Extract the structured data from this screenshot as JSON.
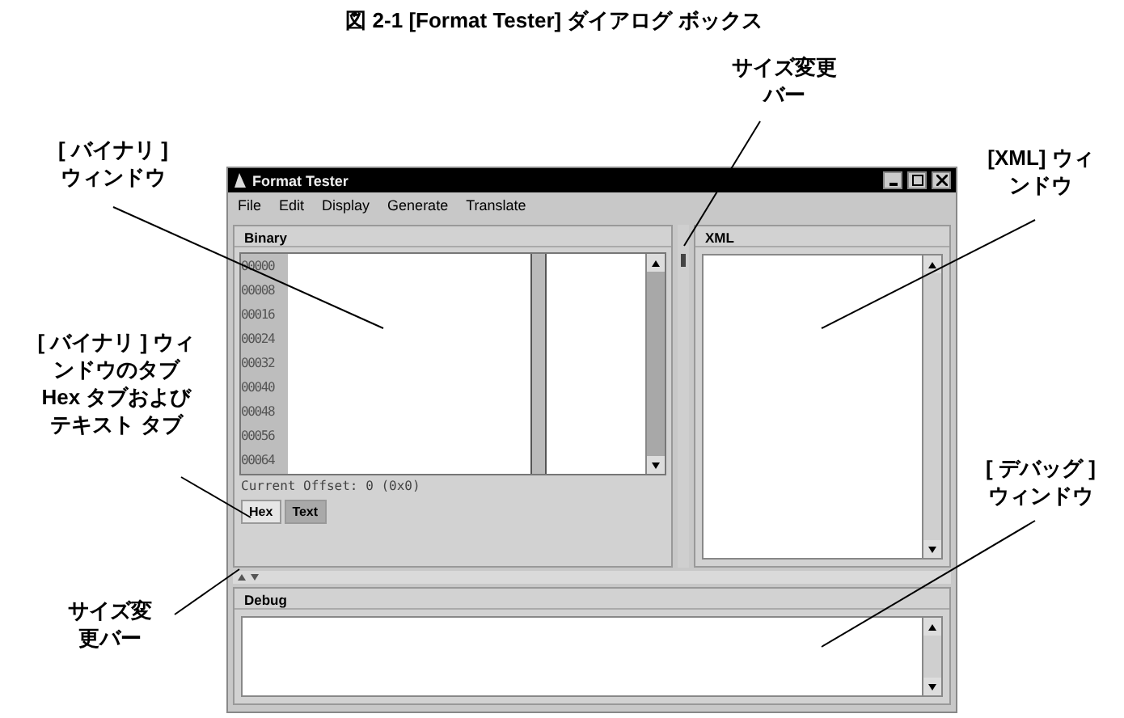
{
  "figure_title": "図 2-1   [Format Tester] ダイアログ ボックス",
  "callouts": [
    {
      "lines": [
        "サイズ変更",
        "バー"
      ]
    },
    {
      "lines": [
        "[ バイナリ ]",
        "ウィンドウ"
      ]
    },
    {
      "lines": [
        "[XML] ウィ",
        "ンドウ"
      ]
    },
    {
      "lines": [
        "[ バイナリ ] ウィ",
        "ンドウのタブ",
        "Hex タブおよび",
        "テキスト タブ"
      ]
    },
    {
      "lines": [
        "[ デバッグ ]",
        "ウィンドウ"
      ]
    },
    {
      "lines": [
        "サイズ変",
        "更バー"
      ]
    }
  ],
  "window": {
    "title": "Format Tester",
    "menu": [
      "File",
      "Edit",
      "Display",
      "Generate",
      "Translate"
    ],
    "binary": {
      "title": "Binary",
      "offsets": [
        "00000",
        "00008",
        "00016",
        "00024",
        "00032",
        "00040",
        "00048",
        "00056",
        "00064"
      ],
      "status": "Current Offset: 0 (0x0)",
      "tabs": [
        {
          "label": "Hex",
          "selected": true
        },
        {
          "label": "Text",
          "selected": false
        }
      ]
    },
    "xml": {
      "title": "XML"
    },
    "debug": {
      "title": "Debug"
    }
  }
}
